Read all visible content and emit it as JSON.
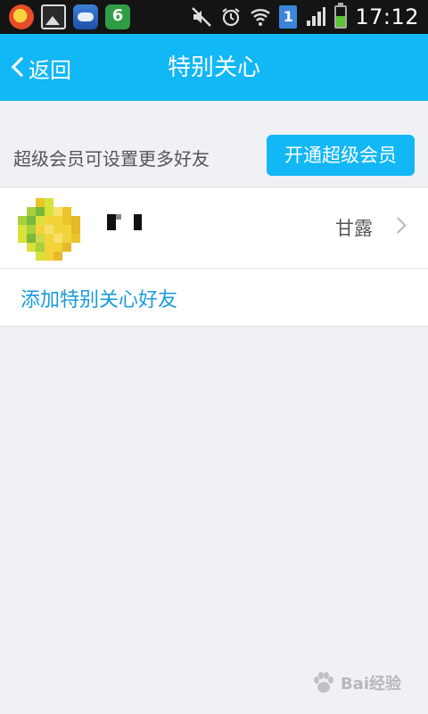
{
  "status_bar": {
    "time": "17:12",
    "sim_slot": "1",
    "battery_level": 0.55,
    "left_icons": [
      "app-icon-red",
      "gallery-icon",
      "cloud-app-icon",
      "lock-app-icon"
    ],
    "right_icons": [
      "mute-icon",
      "alarm-icon",
      "wifi-icon",
      "sim-icon",
      "signal-icon",
      "battery-icon"
    ]
  },
  "header": {
    "back_label": "返回",
    "title": "特别关心"
  },
  "promo": {
    "text": "超级会员可设置更多好友",
    "button_label": "开通超级会员"
  },
  "friends": [
    {
      "remark": "甘露"
    }
  ],
  "add_friend_label": "添加特别关心好友",
  "colors": {
    "accent": "#12b7f5",
    "link": "#1a9bdc",
    "background": "#f0f1f5"
  }
}
